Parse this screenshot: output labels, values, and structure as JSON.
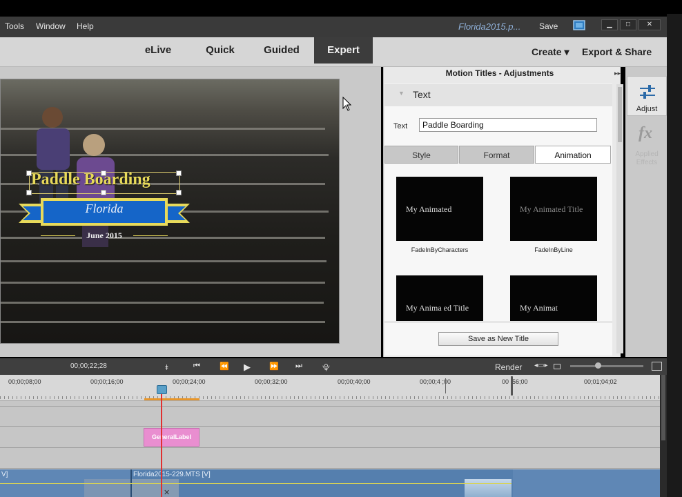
{
  "menubar": {
    "items": [
      "Tools",
      "Window",
      "Help"
    ],
    "document_title": "Florida2015.p...",
    "save_label": "Save"
  },
  "window_controls": {
    "minimize": "▁",
    "maximize": "□",
    "close": "✕"
  },
  "modes": {
    "tabs": [
      "eLive",
      "Quick",
      "Guided",
      "Expert"
    ],
    "active": "Expert"
  },
  "top_actions": {
    "create_label": "Create ▾",
    "export_label": "Export & Share"
  },
  "monitor": {
    "title_text": "Paddle Boarding",
    "banner_text": "Florida",
    "date_text": "June 2015"
  },
  "panel": {
    "title": "Motion Titles - Adjustments",
    "section": "Text",
    "text_field_label": "Text",
    "text_field_value": "Paddle Boarding",
    "subtabs": [
      "Style",
      "Format",
      "Animation"
    ],
    "active_subtab": "Animation",
    "animations": [
      {
        "preview": "My Animated",
        "name": "FadeInByCharacters"
      },
      {
        "preview": "My Animated Title",
        "name": "FadeInByLine"
      },
      {
        "preview": "My Anima ed Title",
        "name": ""
      },
      {
        "preview": "My Animat",
        "name": ""
      }
    ],
    "save_button": "Save as New Title"
  },
  "sidebar": {
    "adjust_label": "Adjust",
    "fx_label": "fx",
    "applied_effects": "Applied Effects"
  },
  "timeline": {
    "timecode": "00;00;22;28",
    "render_label": "Render",
    "ruler": [
      "00;00;08;00",
      "00;00;16;00",
      "00;00;24;00",
      "00;00;32;00",
      "00;00;40;00",
      "00;00;4 ;00",
      "00 ;56;00",
      "00;01;04;02"
    ],
    "general_label": "GeneralLabel",
    "clip_left": "V]",
    "clip_right": "Florida2015-229.MTS [V]"
  },
  "colors": {
    "accent_expert": "#3c3c3c",
    "banner_blue": "#1565c8",
    "title_yellow": "#e8da5a",
    "playhead": "#e03030",
    "label_clip": "#e98ed0"
  }
}
